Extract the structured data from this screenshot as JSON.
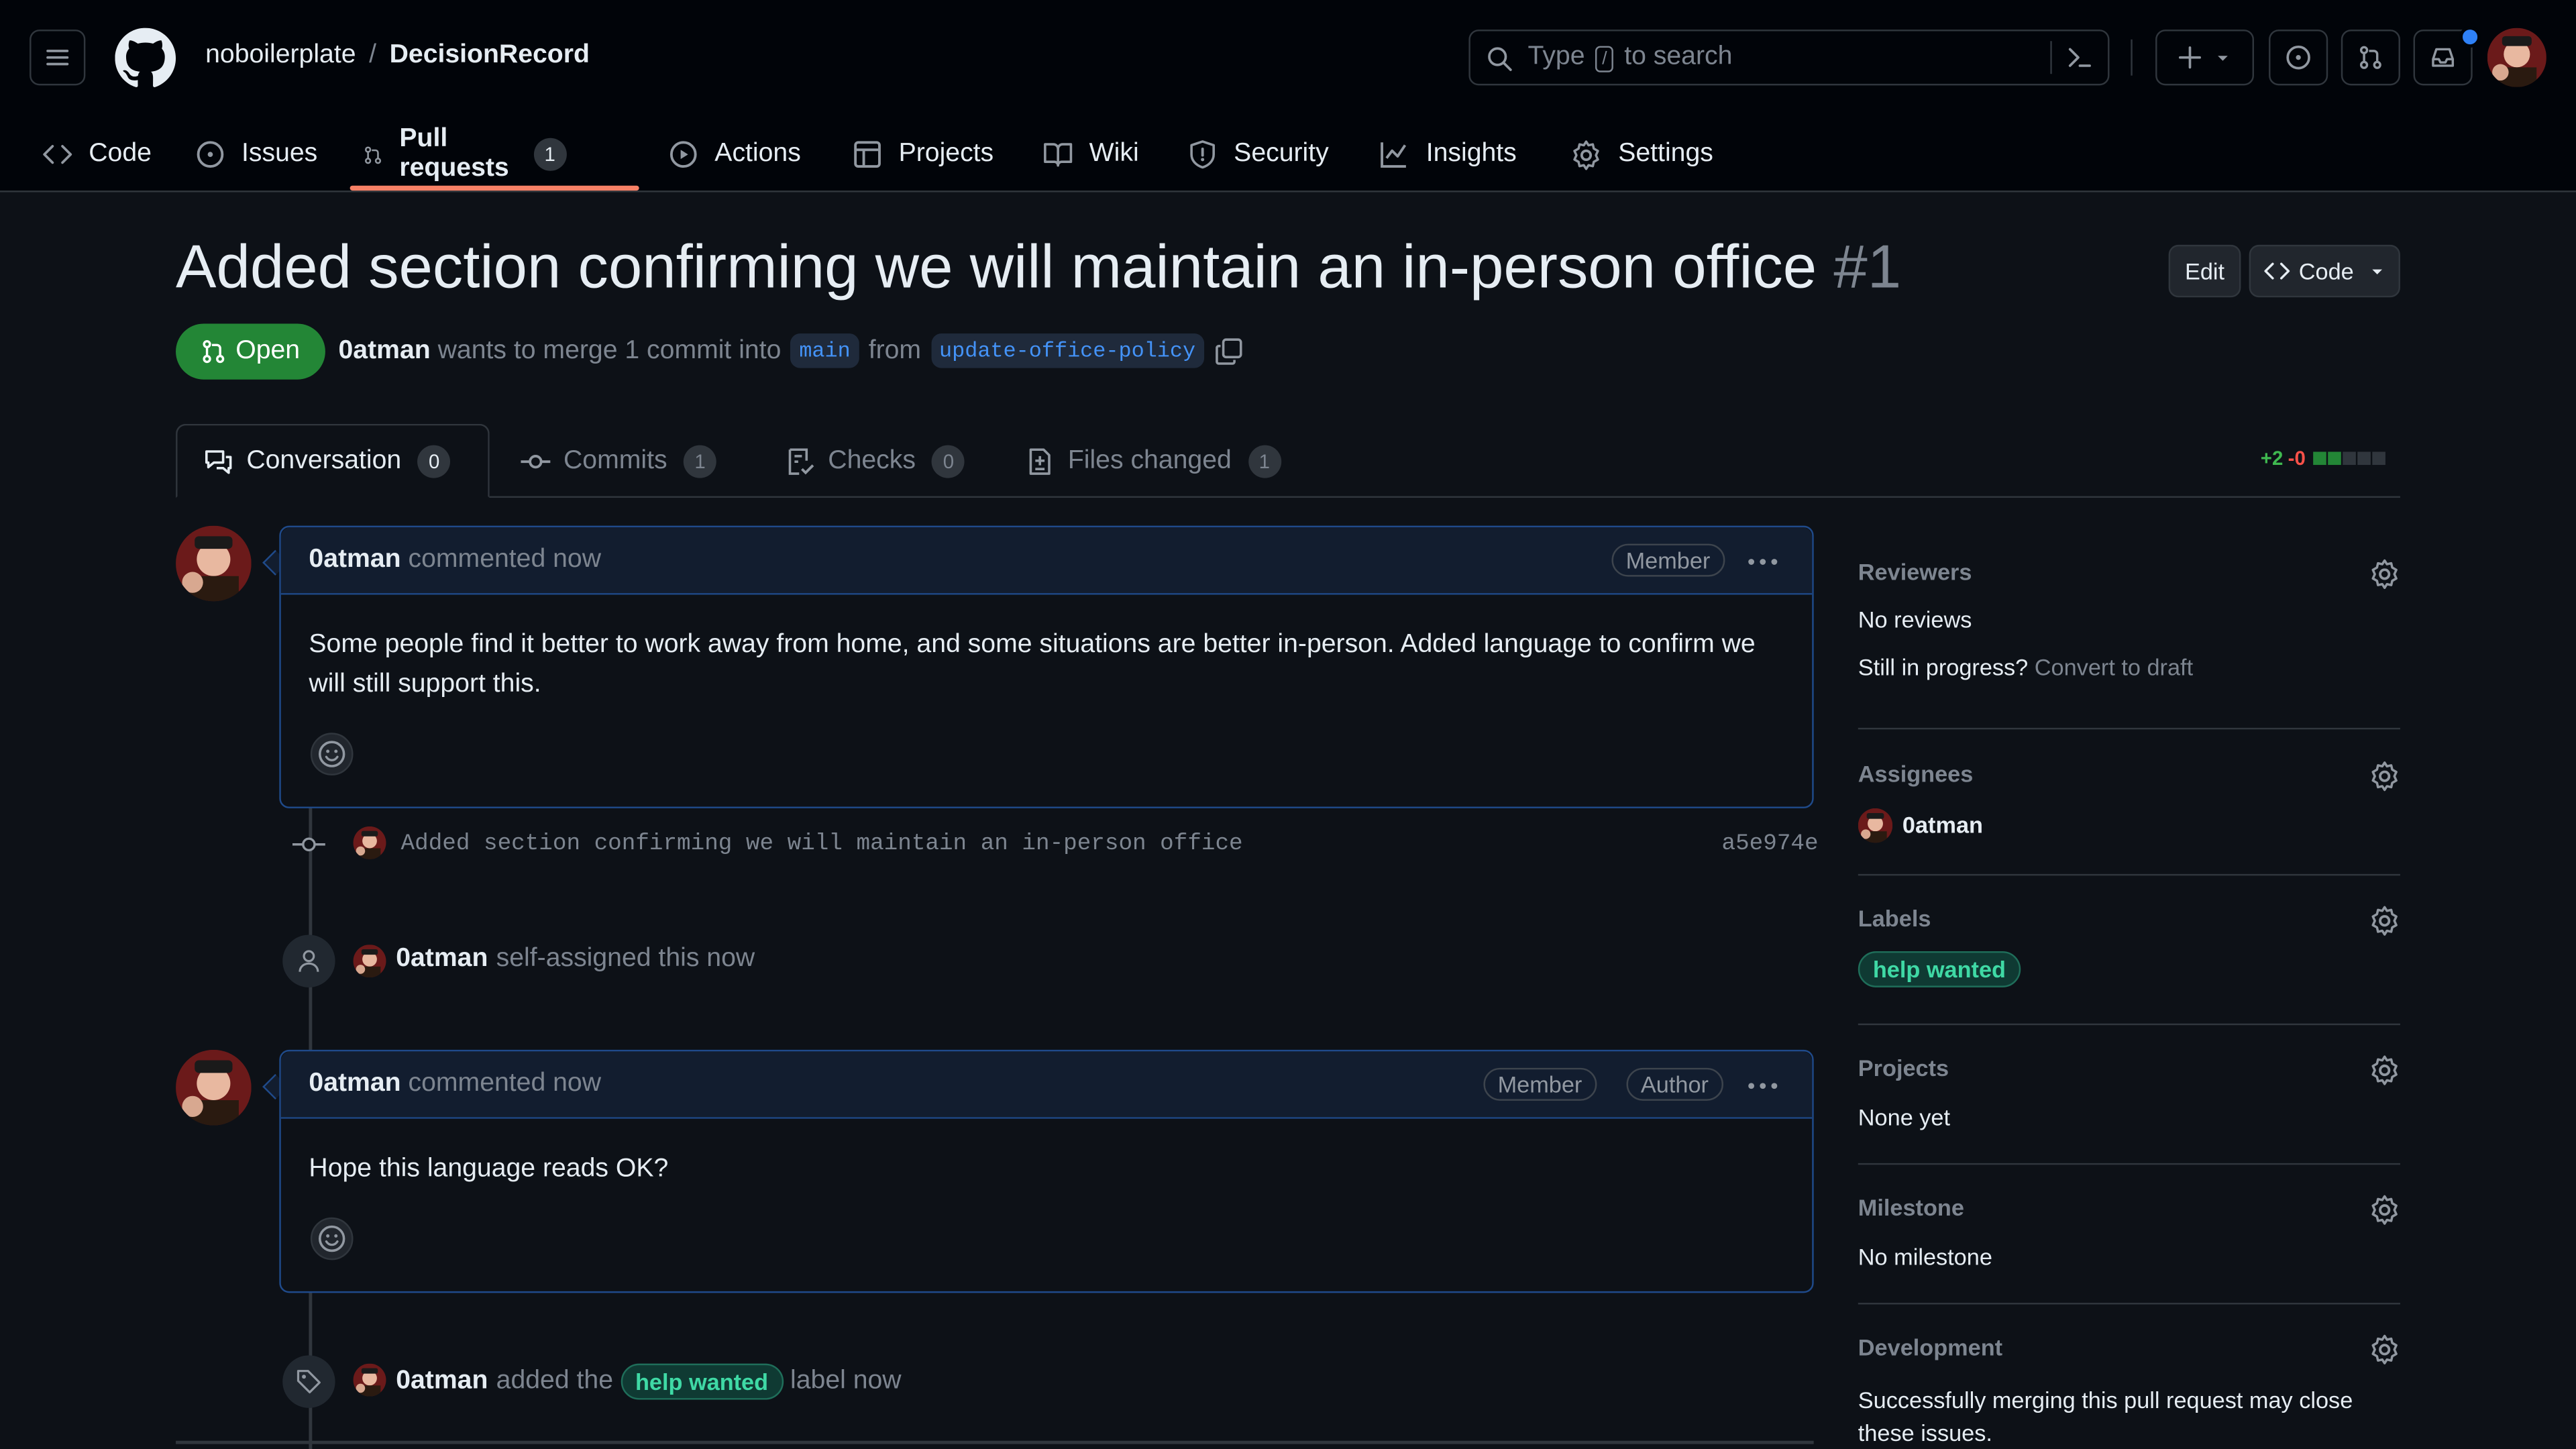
{
  "header": {
    "owner": "noboilerplate",
    "separator": "/",
    "repo": "DecisionRecord",
    "search_before": "Type",
    "search_key": "/",
    "search_after": "to search"
  },
  "repo_nav": {
    "code": "Code",
    "issues": "Issues",
    "pulls": "Pull requests",
    "pulls_count": "1",
    "actions": "Actions",
    "projects": "Projects",
    "wiki": "Wiki",
    "security": "Security",
    "insights": "Insights",
    "settings": "Settings"
  },
  "pr": {
    "title": "Added section confirming we will maintain an in-person office",
    "number": "#1",
    "edit_label": "Edit",
    "code_label": "Code",
    "state": "Open",
    "author": "0atman",
    "merge_text": "wants to merge 1 commit into",
    "base_branch": "main",
    "from_text": "from",
    "head_branch": "update-office-policy"
  },
  "tabs": {
    "conversation": "Conversation",
    "conversation_count": "0",
    "commits": "Commits",
    "commits_count": "1",
    "checks": "Checks",
    "checks_count": "0",
    "files": "Files changed",
    "files_count": "1"
  },
  "diffstat": {
    "additions": "+2",
    "deletions": "-0"
  },
  "timeline": {
    "comment1": {
      "author": "0atman",
      "action": "commented now",
      "badge": "Member",
      "body": "Some people find it better to work away from home, and some situations are better in-person. Added language to confirm we will still support this."
    },
    "commit": {
      "message": "Added section confirming we will maintain an in-person office",
      "sha": "a5e974e"
    },
    "assign_event": {
      "actor": "0atman",
      "text": "self-assigned this now"
    },
    "comment2": {
      "author": "0atman",
      "action": "commented now",
      "badge_member": "Member",
      "badge_author": "Author",
      "body": "Hope this language reads OK?"
    },
    "label_event": {
      "actor": "0atman",
      "text_before": "added the",
      "label": "help wanted",
      "text_after": "label now"
    }
  },
  "sidebar": {
    "reviewers": {
      "heading": "Reviewers",
      "value": "No reviews",
      "draft_q": "Still in progress?",
      "draft_link": "Convert to draft"
    },
    "assignees": {
      "heading": "Assignees",
      "value": "0atman"
    },
    "labels": {
      "heading": "Labels",
      "value": "help wanted"
    },
    "projects": {
      "heading": "Projects",
      "value": "None yet"
    },
    "milestone": {
      "heading": "Milestone",
      "value": "No milestone"
    },
    "development": {
      "heading": "Development",
      "value": "Successfully merging this pull request may close these issues."
    }
  },
  "colors": {
    "accent_open": "#238636",
    "tab_underline": "#f78166",
    "label_text": "#3fd9a5",
    "link": "#4493f8"
  },
  "icons": [
    "hamburger-icon",
    "github-logo-icon",
    "search-icon",
    "command-palette-icon",
    "plus-icon",
    "issue-icon",
    "pull-request-icon",
    "inbox-icon",
    "code-icon",
    "play-icon",
    "table-icon",
    "book-icon",
    "shield-icon",
    "graph-icon",
    "gear-icon",
    "copy-icon",
    "comment-icon",
    "commit-icon",
    "checklist-icon",
    "file-diff-icon",
    "kebab-icon",
    "smiley-icon",
    "person-icon",
    "tag-icon"
  ]
}
